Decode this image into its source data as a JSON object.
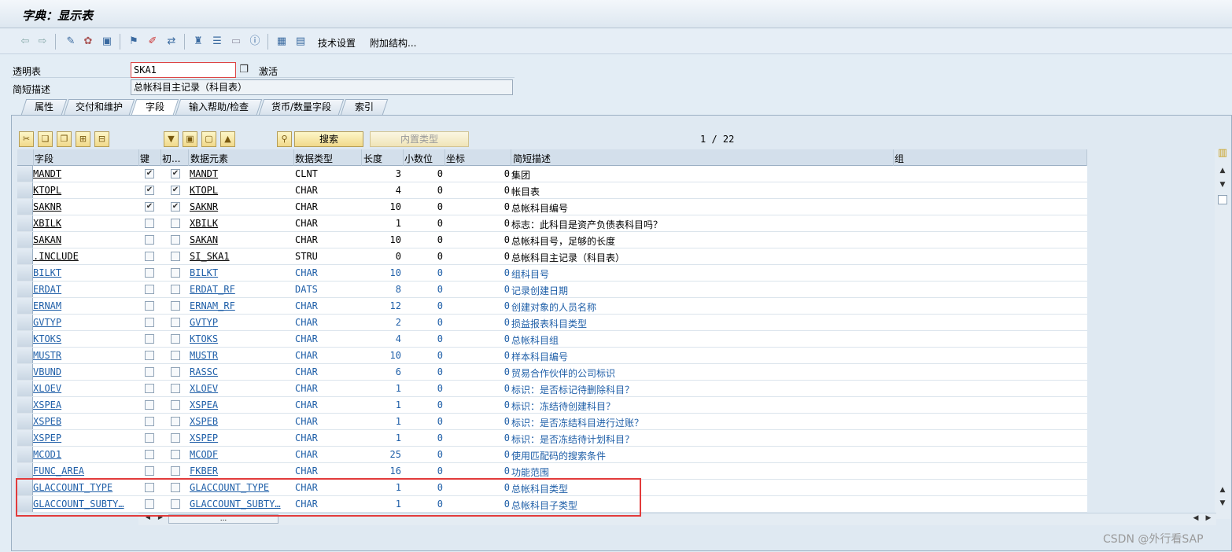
{
  "window": {
    "title": "字典：显示表"
  },
  "toolbar": {
    "tech_settings_label": "技术设置",
    "append_structure_label": "附加结构..."
  },
  "header": {
    "table_label": "透明表",
    "table_value": "SKA1",
    "status": "激活",
    "desc_label": "简短描述",
    "desc_value": "总帐科目主记录（科目表）"
  },
  "tabs": [
    "属性",
    "交付和维护",
    "字段",
    "输入帮助/检查",
    "货币/数量字段",
    "索引"
  ],
  "active_tab_index": 2,
  "buttons": {
    "search": "搜索",
    "builtin_type": "内置类型"
  },
  "pager": "1 / 22",
  "columns": [
    "字段",
    "键",
    "初...",
    "数据元素",
    "数据类型",
    "长度",
    "小数位",
    "坐标",
    "简短描述",
    "组"
  ],
  "rows": [
    {
      "field": "MANDT",
      "key": true,
      "init": true,
      "element": "MANDT",
      "type": "CLNT",
      "len": "3",
      "dec": "0",
      "coord": "0",
      "desc": "集团",
      "blue": false
    },
    {
      "field": "KTOPL",
      "key": true,
      "init": true,
      "element": "KTOPL",
      "type": "CHAR",
      "len": "4",
      "dec": "0",
      "coord": "0",
      "desc": "帐目表",
      "blue": false
    },
    {
      "field": "SAKNR",
      "key": true,
      "init": true,
      "element": "SAKNR",
      "type": "CHAR",
      "len": "10",
      "dec": "0",
      "coord": "0",
      "desc": "总帐科目编号",
      "blue": false
    },
    {
      "field": "XBILK",
      "key": false,
      "init": false,
      "element": "XBILK",
      "type": "CHAR",
      "len": "1",
      "dec": "0",
      "coord": "0",
      "desc": "标志：此科目是资产负债表科目吗？",
      "blue": false
    },
    {
      "field": "SAKAN",
      "key": false,
      "init": false,
      "element": "SAKAN",
      "type": "CHAR",
      "len": "10",
      "dec": "0",
      "coord": "0",
      "desc": "总帐科目号，足够的长度",
      "blue": false
    },
    {
      "field": ".INCLUDE",
      "key": false,
      "init": false,
      "element": "SI_SKA1",
      "type": "STRU",
      "len": "0",
      "dec": "0",
      "coord": "0",
      "desc": "总帐科目主记录（科目表）",
      "blue": false
    },
    {
      "field": "BILKT",
      "key": false,
      "init": false,
      "element": "BILKT",
      "type": "CHAR",
      "len": "10",
      "dec": "0",
      "coord": "0",
      "desc": "组科目号",
      "blue": true
    },
    {
      "field": "ERDAT",
      "key": false,
      "init": false,
      "element": "ERDAT_RF",
      "type": "DATS",
      "len": "8",
      "dec": "0",
      "coord": "0",
      "desc": "记录创建日期",
      "blue": true
    },
    {
      "field": "ERNAM",
      "key": false,
      "init": false,
      "element": "ERNAM_RF",
      "type": "CHAR",
      "len": "12",
      "dec": "0",
      "coord": "0",
      "desc": "创建对象的人员名称",
      "blue": true
    },
    {
      "field": "GVTYP",
      "key": false,
      "init": false,
      "element": "GVTYP",
      "type": "CHAR",
      "len": "2",
      "dec": "0",
      "coord": "0",
      "desc": "损益报表科目类型",
      "blue": true
    },
    {
      "field": "KTOKS",
      "key": false,
      "init": false,
      "element": "KTOKS",
      "type": "CHAR",
      "len": "4",
      "dec": "0",
      "coord": "0",
      "desc": "总帐科目组",
      "blue": true
    },
    {
      "field": "MUSTR",
      "key": false,
      "init": false,
      "element": "MUSTR",
      "type": "CHAR",
      "len": "10",
      "dec": "0",
      "coord": "0",
      "desc": "样本科目编号",
      "blue": true
    },
    {
      "field": "VBUND",
      "key": false,
      "init": false,
      "element": "RASSC",
      "type": "CHAR",
      "len": "6",
      "dec": "0",
      "coord": "0",
      "desc": "贸易合作伙伴的公司标识",
      "blue": true
    },
    {
      "field": "XLOEV",
      "key": false,
      "init": false,
      "element": "XLOEV",
      "type": "CHAR",
      "len": "1",
      "dec": "0",
      "coord": "0",
      "desc": "标识：是否标记待删除科目？",
      "blue": true
    },
    {
      "field": "XSPEA",
      "key": false,
      "init": false,
      "element": "XSPEA",
      "type": "CHAR",
      "len": "1",
      "dec": "0",
      "coord": "0",
      "desc": "标识：冻结待创建科目？",
      "blue": true
    },
    {
      "field": "XSPEB",
      "key": false,
      "init": false,
      "element": "XSPEB",
      "type": "CHAR",
      "len": "1",
      "dec": "0",
      "coord": "0",
      "desc": "标识：是否冻结科目进行过账？",
      "blue": true
    },
    {
      "field": "XSPEP",
      "key": false,
      "init": false,
      "element": "XSPEP",
      "type": "CHAR",
      "len": "1",
      "dec": "0",
      "coord": "0",
      "desc": "标识：是否冻结待计划科目？",
      "blue": true
    },
    {
      "field": "MCOD1",
      "key": false,
      "init": false,
      "element": "MCODF",
      "type": "CHAR",
      "len": "25",
      "dec": "0",
      "coord": "0",
      "desc": "使用匹配码的搜索条件",
      "blue": true
    },
    {
      "field": "FUNC_AREA",
      "key": false,
      "init": false,
      "element": "FKBER",
      "type": "CHAR",
      "len": "16",
      "dec": "0",
      "coord": "0",
      "desc": "功能范围",
      "blue": true
    },
    {
      "field": "GLACCOUNT_TYPE",
      "key": false,
      "init": false,
      "element": "GLACCOUNT_TYPE",
      "type": "CHAR",
      "len": "1",
      "dec": "0",
      "coord": "0",
      "desc": "总帐科目类型",
      "blue": true
    },
    {
      "field": "GLACCOUNT_SUBTY…",
      "key": false,
      "init": false,
      "element": "GLACCOUNT_SUBTY…",
      "type": "CHAR",
      "len": "1",
      "dec": "0",
      "coord": "0",
      "desc": "总帐科目子类型",
      "blue": true
    }
  ],
  "hscroll_label": "...",
  "watermark": "CSDN @外行看SAP",
  "colors": {
    "link_blue": "#1f5fa8",
    "highlight_red": "#e23b3b"
  }
}
